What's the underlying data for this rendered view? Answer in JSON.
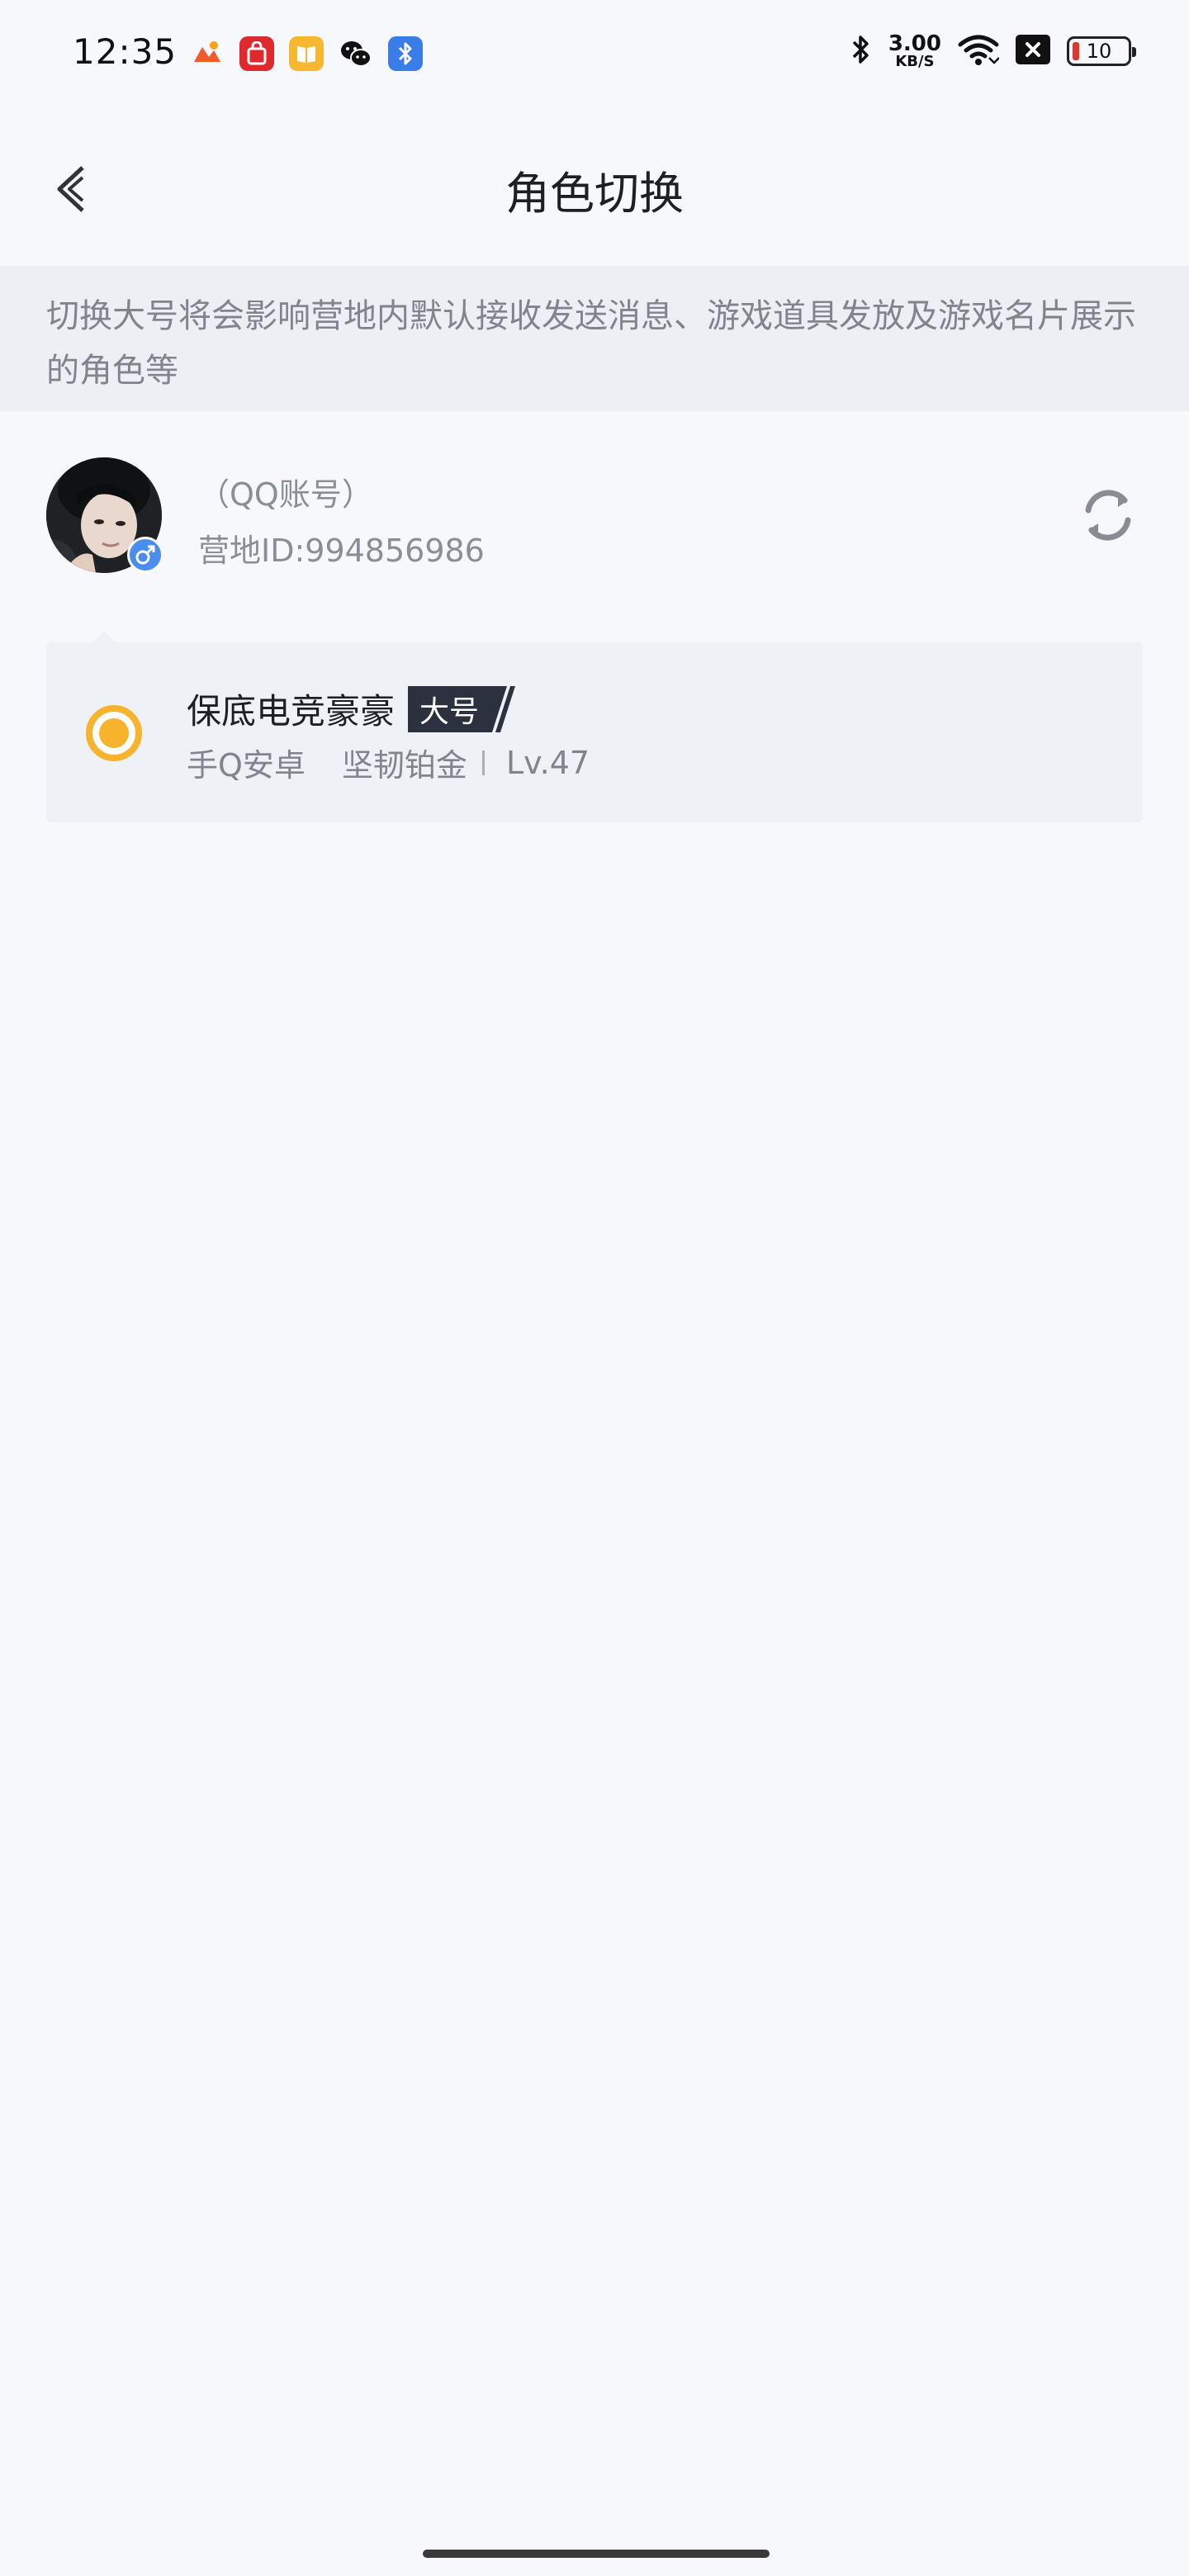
{
  "status_bar": {
    "time": "12:35",
    "notification_icons": [
      "photos-app-icon",
      "shopping-bag-app-icon",
      "reader-app-icon",
      "wechat-icon",
      "bluetooth-app-icon"
    ],
    "net_speed_value": "3.00",
    "net_speed_unit": "KB/S",
    "battery_level": "10",
    "battery_color": "#e0362c"
  },
  "header": {
    "title": "角色切换"
  },
  "notice": {
    "text": "切换大号将会影响营地内默认接收发送消息、游戏道具发放及游戏名片展示的角色等"
  },
  "account": {
    "type_label": "（QQ账号）",
    "camp_id": "营地ID:994856986",
    "gender": "male",
    "gender_symbol": "♂"
  },
  "role": {
    "name": "保底电竞豪豪",
    "tag": "大号",
    "platform": "手Q安卓",
    "rank": "坚韧铂金",
    "level": "Lv.47",
    "selected": true,
    "accent_color": "#f7b32b"
  }
}
